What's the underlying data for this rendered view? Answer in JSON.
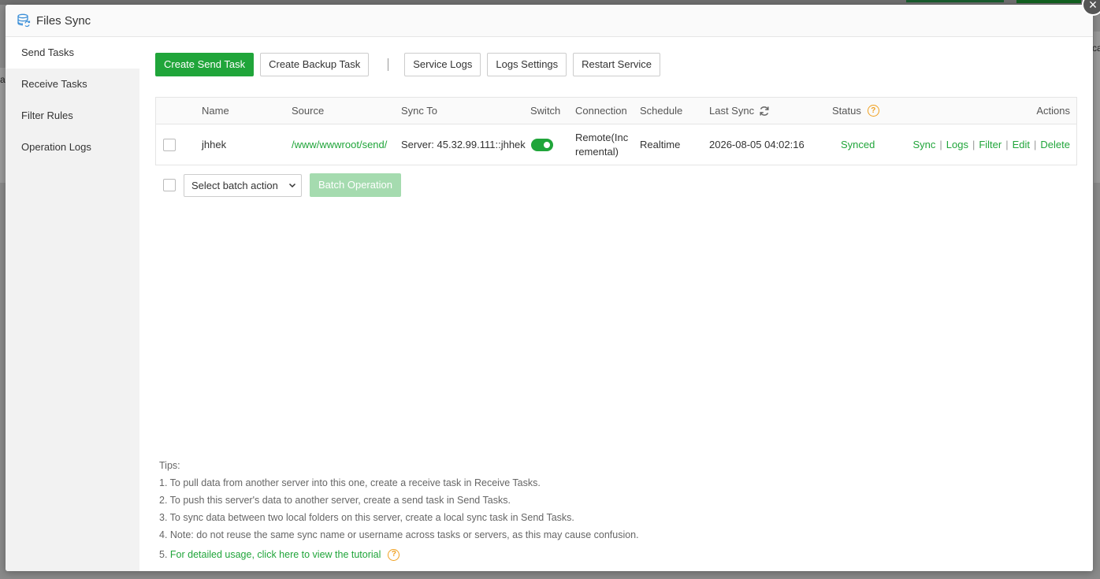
{
  "background": {
    "left_fragment": "al",
    "right_fragment": "ca"
  },
  "modal": {
    "title": "Files Sync",
    "close_symbol": "×"
  },
  "sidebar": {
    "items": [
      {
        "label": "Send Tasks",
        "active": true
      },
      {
        "label": "Receive Tasks",
        "active": false
      },
      {
        "label": "Filter Rules",
        "active": false
      },
      {
        "label": "Operation Logs",
        "active": false
      }
    ]
  },
  "toolbar": {
    "create_send": "Create Send Task",
    "create_backup": "Create Backup Task",
    "service_logs": "Service Logs",
    "logs_settings": "Logs Settings",
    "restart_service": "Restart Service"
  },
  "table": {
    "headers": {
      "name": "Name",
      "source": "Source",
      "sync_to": "Sync To",
      "switch": "Switch",
      "connection": "Connection",
      "schedule": "Schedule",
      "last_sync": "Last Sync",
      "status": "Status",
      "actions": "Actions"
    },
    "rows": [
      {
        "name": "jhhek",
        "source": "/www/wwwroot/send/",
        "sync_to": "Server: 45.32.99.111::jhhek",
        "switch_on": true,
        "connection_line1": "Remote(Inc",
        "connection_line2": "remental)",
        "schedule": "Realtime",
        "last_sync": "2026-08-05 04:02:16",
        "status": "Synced",
        "actions": [
          "Sync",
          "Logs",
          "Filter",
          "Edit",
          "Delete"
        ]
      }
    ]
  },
  "batch": {
    "select_value": "Select batch action",
    "button": "Batch Operation"
  },
  "tips": {
    "title": "Tips:",
    "items": [
      "1. To pull data from another server into this one, create a receive task in Receive Tasks.",
      "2. To push this server's data to another server, create a send task in Send Tasks.",
      "3. To sync data between two local folders on this server, create a local sync task in Send Tasks.",
      "4. Note: do not reuse the same sync name or username across tasks or servers, as this may cause confusion."
    ],
    "tutorial_prefix": "5. ",
    "tutorial_link": "For detailed usage, click here to view the tutorial"
  },
  "colors": {
    "accent": "#20a53a",
    "help": "#f0a020"
  },
  "icons": [
    "database-sync-icon",
    "close-icon",
    "refresh-icon",
    "help-icon",
    "chevron-down-icon"
  ]
}
